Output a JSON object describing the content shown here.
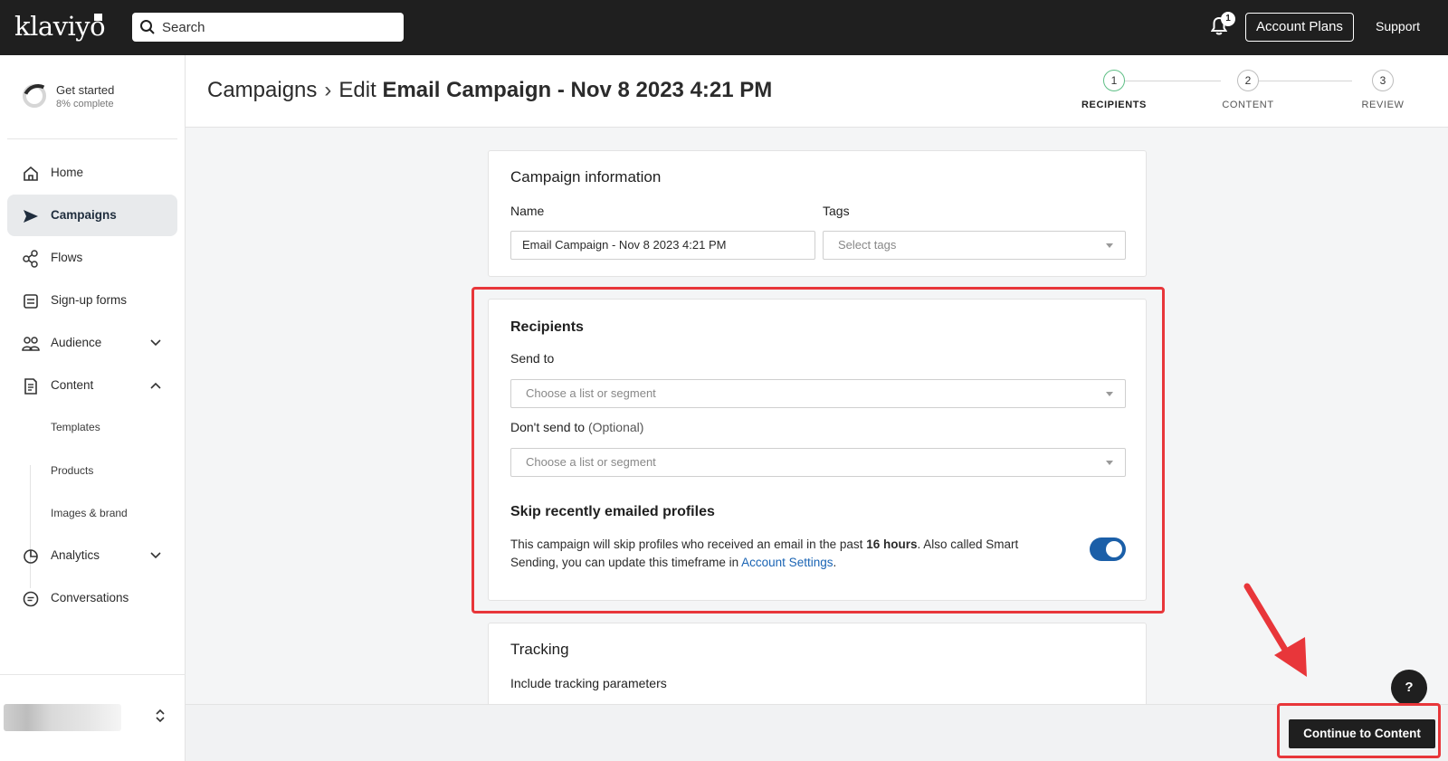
{
  "app": {
    "logo": "klaviyo"
  },
  "topbar": {
    "search_placeholder": "Search",
    "notification_count": "1",
    "account_plans_label": "Account Plans",
    "support_label": "Support"
  },
  "sidebar": {
    "get_started": {
      "title": "Get started",
      "progress_text": "8% complete",
      "progress_percent": 8
    },
    "items": [
      {
        "label": "Home",
        "icon": "home-icon"
      },
      {
        "label": "Campaigns",
        "icon": "send-icon",
        "active": true
      },
      {
        "label": "Flows",
        "icon": "flows-icon"
      },
      {
        "label": "Sign-up forms",
        "icon": "form-icon"
      },
      {
        "label": "Audience",
        "icon": "users-icon",
        "expanded": false
      },
      {
        "label": "Content",
        "icon": "document-icon",
        "expanded": true
      },
      {
        "label": "Analytics",
        "icon": "pie-chart-icon",
        "expanded": false
      },
      {
        "label": "Conversations",
        "icon": "chat-icon"
      }
    ],
    "content_sub_items": [
      "Templates",
      "Products",
      "Images & brand"
    ]
  },
  "header": {
    "breadcrumb_root": "Campaigns",
    "breadcrumb_prefix": "Edit",
    "breadcrumb_title": "Email Campaign - Nov 8 2023 4:21 PM",
    "steps": [
      {
        "number": "1",
        "label": "RECIPIENTS",
        "active": true
      },
      {
        "number": "2",
        "label": "CONTENT",
        "active": false
      },
      {
        "number": "3",
        "label": "REVIEW",
        "active": false
      }
    ]
  },
  "campaign_info": {
    "title": "Campaign information",
    "name_label": "Name",
    "name_value": "Email Campaign - Nov 8 2023 4:21 PM",
    "tags_label": "Tags",
    "tags_placeholder": "Select tags"
  },
  "recipients": {
    "title": "Recipients",
    "send_to_label": "Send to",
    "send_to_placeholder": "Choose a list or segment",
    "dont_send_label": "Don't send to",
    "dont_send_optional": "(Optional)",
    "dont_send_placeholder": "Choose a list or segment",
    "skip_title": "Skip recently emailed profiles",
    "skip_text_1": "This campaign will skip profiles who received an email in the past ",
    "skip_hours": "16 hours",
    "skip_text_2": ". Also called Smart Sending, you can update this timeframe in ",
    "skip_link": "Account Settings",
    "skip_text_3": ".",
    "smart_sending_enabled": true
  },
  "tracking": {
    "title": "Tracking",
    "include_label": "Include tracking parameters"
  },
  "footer": {
    "continue_label": "Continue to Content",
    "help_label": "?"
  },
  "colors": {
    "topbar": "#1f1f1f",
    "accent_blue": "#1b5fa8",
    "step_active": "#5fbf86",
    "highlight_red": "#e8363a"
  }
}
